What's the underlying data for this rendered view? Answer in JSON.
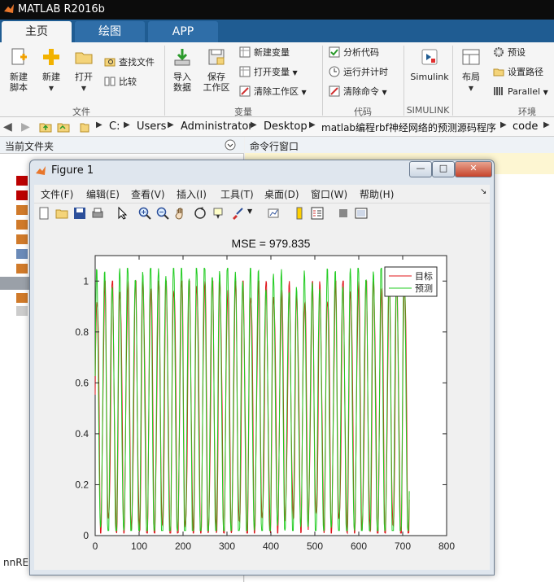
{
  "app": {
    "title": "MATLAB R2016b"
  },
  "tabs": [
    {
      "label": "主页"
    },
    {
      "label": "绘图"
    },
    {
      "label": "APP"
    }
  ],
  "ribbon": {
    "new_script": {
      "line1": "新建",
      "line2": "脚本"
    },
    "new": {
      "label": "新建"
    },
    "open": {
      "label": "打开"
    },
    "find_files": "查找文件",
    "compare": "比较",
    "import": {
      "line1": "导入",
      "line2": "数据"
    },
    "save_ws": {
      "line1": "保存",
      "line2": "工作区"
    },
    "new_var": "新建变量",
    "open_var": "打开变量",
    "clear_ws": "清除工作区",
    "analyze_code": "分析代码",
    "run_time": "运行并计时",
    "clear_cmd": "清除命令",
    "simulink": "Simulink",
    "layout": "布局",
    "prefs": "预设",
    "set_path": "设置路径",
    "parallel": "Parallel",
    "sections": {
      "file": "文件",
      "variable": "变量",
      "code": "代码",
      "simulink": "SIMULINK",
      "env": "环境"
    }
  },
  "address": {
    "crumbs": [
      "C:",
      "Users",
      "Administrator",
      "Desktop",
      "matlab编程rbf神经网络的预测源码程序",
      "code"
    ]
  },
  "panels": {
    "current_folder": "当前文件夹",
    "command_window": "命令行窗口",
    "left_bottom": "nnRE"
  },
  "figure": {
    "title": "Figure 1",
    "menu": [
      "文件(F)",
      "编辑(E)",
      "查看(V)",
      "插入(I)",
      "工具(T)",
      "桌面(D)",
      "窗口(W)",
      "帮助(H)"
    ],
    "win_buttons": {
      "min": "—",
      "max": "□",
      "close": "✕"
    }
  },
  "colors": {
    "target": "#e0141a",
    "predict": "#22cc22",
    "ribbon_tab": "#1f5c92"
  },
  "chart_data": {
    "type": "line",
    "title": "MSE = 979.835",
    "xlabel": "",
    "ylabel": "",
    "xlim": [
      0,
      800
    ],
    "ylim": [
      0,
      1.1
    ],
    "xticks": [
      "0",
      "100",
      "200",
      "300",
      "400",
      "500",
      "600",
      "700",
      "800"
    ],
    "yticks": [
      "0",
      "0.2",
      "0.4",
      "0.6",
      "0.8",
      "1"
    ],
    "legend_position": "top-right",
    "series": [
      {
        "name": "目标",
        "color": "#e0141a",
        "n": 716,
        "period": 17.5,
        "description_values": "oscillating between ~0.0 and ~1.0"
      },
      {
        "name": "预测",
        "color": "#22cc22",
        "n": 716,
        "period": 17.5,
        "description_values": "oscillating between ~0.02 and ~1.05"
      }
    ]
  }
}
